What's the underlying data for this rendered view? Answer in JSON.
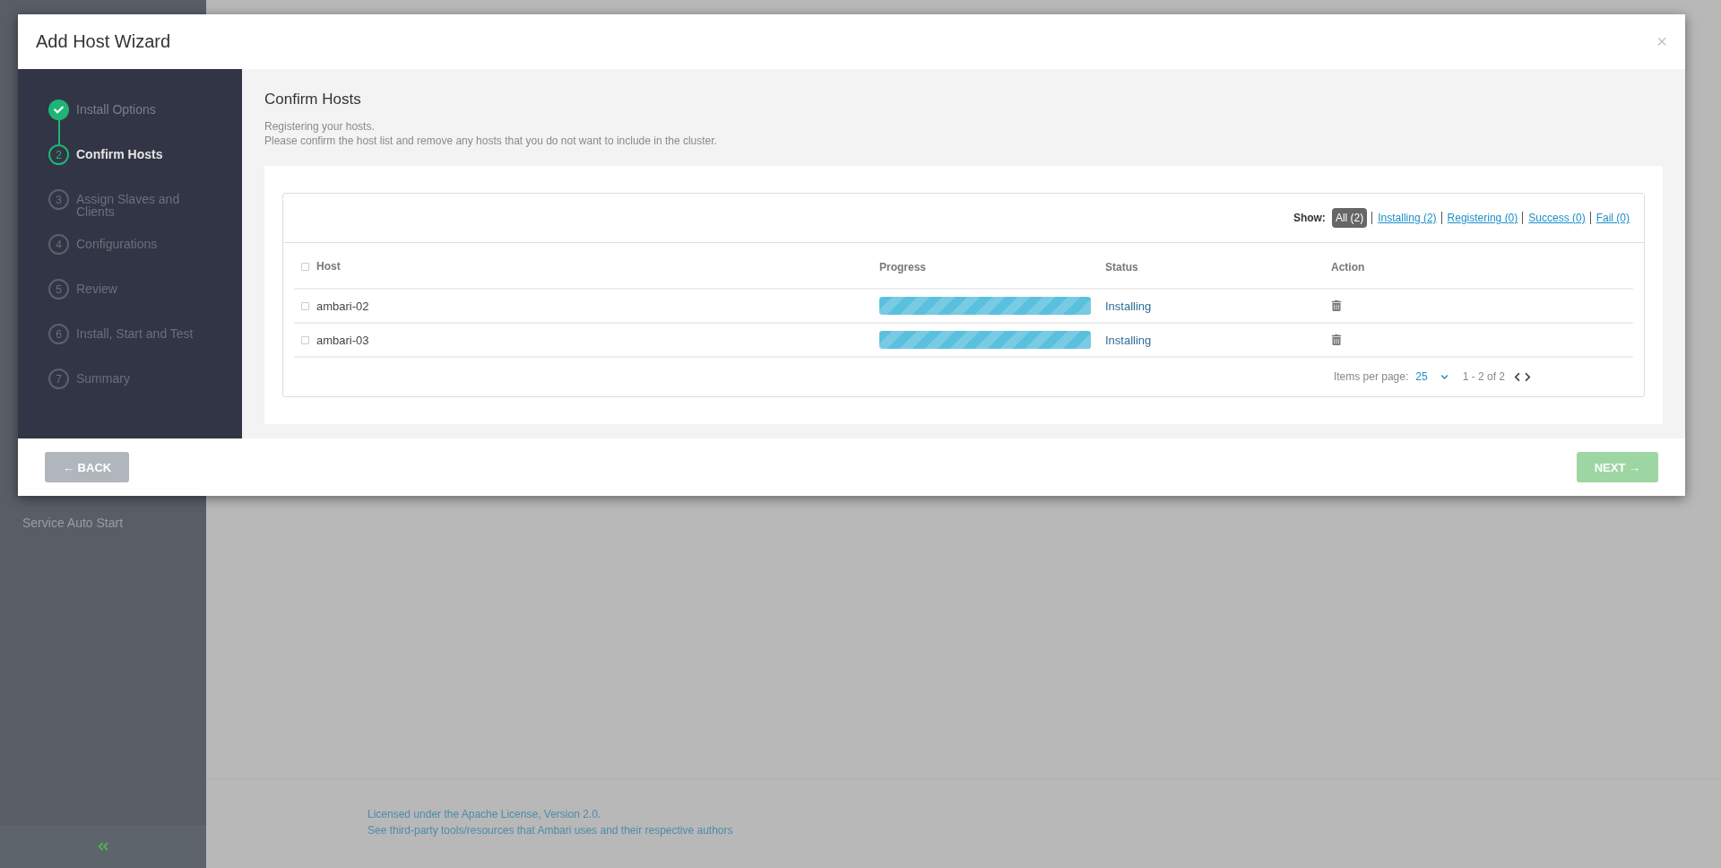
{
  "background": {
    "nav_items": [
      "Service Auto Start"
    ],
    "footer": [
      "Licensed under the Apache License, Version 2.0.",
      "See third-party tools/resources that Ambari uses and their respective authors"
    ]
  },
  "wizard": {
    "title": "Add Host Wizard",
    "close": "×",
    "steps": [
      {
        "label": "Install Options",
        "completed": true,
        "selected": false
      },
      {
        "number": "2",
        "label": "Confirm Hosts",
        "completed": false,
        "selected": true
      },
      {
        "number": "3",
        "label": "Assign Slaves and Clients",
        "completed": false,
        "selected": false
      },
      {
        "number": "4",
        "label": "Configurations",
        "completed": false,
        "selected": false
      },
      {
        "number": "5",
        "label": "Review",
        "completed": false,
        "selected": false
      },
      {
        "number": "6",
        "label": "Install, Start and Test",
        "completed": false,
        "selected": false
      },
      {
        "number": "7",
        "label": "Summary",
        "completed": false,
        "selected": false
      }
    ],
    "content": {
      "title": "Confirm Hosts",
      "description": [
        "Registering your hosts.",
        "Please confirm the host list and remove any hosts that you do not want to include in the cluster."
      ]
    },
    "filter": {
      "label": "Show:",
      "options": [
        {
          "label": "All (2)",
          "selected": true
        },
        {
          "label": "Installing (2)",
          "selected": false
        },
        {
          "label": "Registering (0)",
          "selected": false
        },
        {
          "label": "Success (0)",
          "selected": false
        },
        {
          "label": "Fail (0)",
          "selected": false
        }
      ]
    },
    "table": {
      "select_all_checked": false,
      "columns": [
        "Host",
        "Progress",
        "Status",
        "Action"
      ],
      "rows": [
        {
          "checked": false,
          "host": "ambari-02",
          "level": 1,
          "status": "Installing"
        },
        {
          "checked": false,
          "host": "ambari-03",
          "level": 1,
          "status": "Installing"
        }
      ]
    },
    "pagination": {
      "label": "Items per page:",
      "per_page": "25",
      "range": "1 - 2 of 2"
    },
    "buttons": {
      "back": {
        "label": "← BACK"
      },
      "next": {
        "label": "NEXT →",
        "disabled": true
      }
    }
  }
}
